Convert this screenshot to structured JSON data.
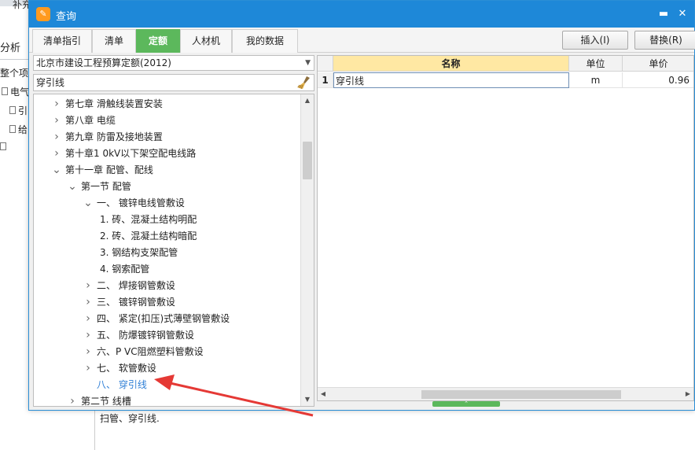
{
  "background_app": {
    "top_label": "补充",
    "analysis_tab": "分析",
    "tree_items": [
      "整个项目",
      "电气",
      "引",
      "给"
    ],
    "bottom_text": "扫管、穿引线."
  },
  "dialog": {
    "title": "查询",
    "window_buttons": {
      "minimize": "▬",
      "close": "✕"
    },
    "tabs": [
      {
        "label": "清单指引",
        "active": false
      },
      {
        "label": "清单",
        "active": false
      },
      {
        "label": "定额",
        "active": true
      },
      {
        "label": "人材机",
        "active": false
      },
      {
        "label": "我的数据",
        "active": false
      }
    ],
    "buttons": {
      "insert": "插入(I)",
      "replace": "替换(R)"
    },
    "quota_library": "北京市建设工程预算定额(2012)",
    "search_value": "穿引线",
    "tree": [
      {
        "label": "第七章 滑触线装置安装",
        "level": 0,
        "expander": "collapsed"
      },
      {
        "label": "第八章 电缆",
        "level": 0,
        "expander": "collapsed"
      },
      {
        "label": "第九章 防雷及接地装置",
        "level": 0,
        "expander": "collapsed"
      },
      {
        "label": "第十章1 0kV以下架空配电线路",
        "level": 0,
        "expander": "collapsed"
      },
      {
        "label": "第十一章 配管、配线",
        "level": 0,
        "expander": "expanded"
      },
      {
        "label": "第一节 配管",
        "level": 1,
        "expander": "expanded"
      },
      {
        "label": "一、 镀锌电线管敷设",
        "level": 2,
        "expander": "expanded"
      },
      {
        "label": "1. 砖、混凝土结构明配",
        "level": 3,
        "expander": "none"
      },
      {
        "label": "2. 砖、混凝土结构暗配",
        "level": 3,
        "expander": "none"
      },
      {
        "label": "3. 钢结构支架配管",
        "level": 3,
        "expander": "none"
      },
      {
        "label": "4. 钢索配管",
        "level": 3,
        "expander": "none"
      },
      {
        "label": "二、 焊接钢管敷设",
        "level": 2,
        "expander": "collapsed"
      },
      {
        "label": "三、 镀锌钢管敷设",
        "level": 2,
        "expander": "collapsed"
      },
      {
        "label": "四、 紧定(扣压)式薄壁钢管敷设",
        "level": 2,
        "expander": "collapsed"
      },
      {
        "label": "五、 防爆镀锌钢管敷设",
        "level": 2,
        "expander": "collapsed"
      },
      {
        "label": "六、P VC阻燃塑料管敷设",
        "level": 2,
        "expander": "collapsed"
      },
      {
        "label": "七、 软管敷设",
        "level": 2,
        "expander": "collapsed"
      },
      {
        "label": "八、 穿引线",
        "level": 2,
        "expander": "none",
        "highlight": true
      },
      {
        "label": "第二节 线槽",
        "level": 1,
        "expander": "collapsed"
      }
    ],
    "grid": {
      "columns": [
        "名称",
        "单位",
        "单价"
      ],
      "rows": [
        {
          "no": "1",
          "name": "穿引线",
          "unit": "m",
          "price": "0.96"
        }
      ]
    }
  },
  "colors": {
    "titlebar": "#1e88d8",
    "active_tab": "#5cb85c",
    "highlight_text": "#2f7fd6",
    "annotation_arrow": "#e53935"
  }
}
